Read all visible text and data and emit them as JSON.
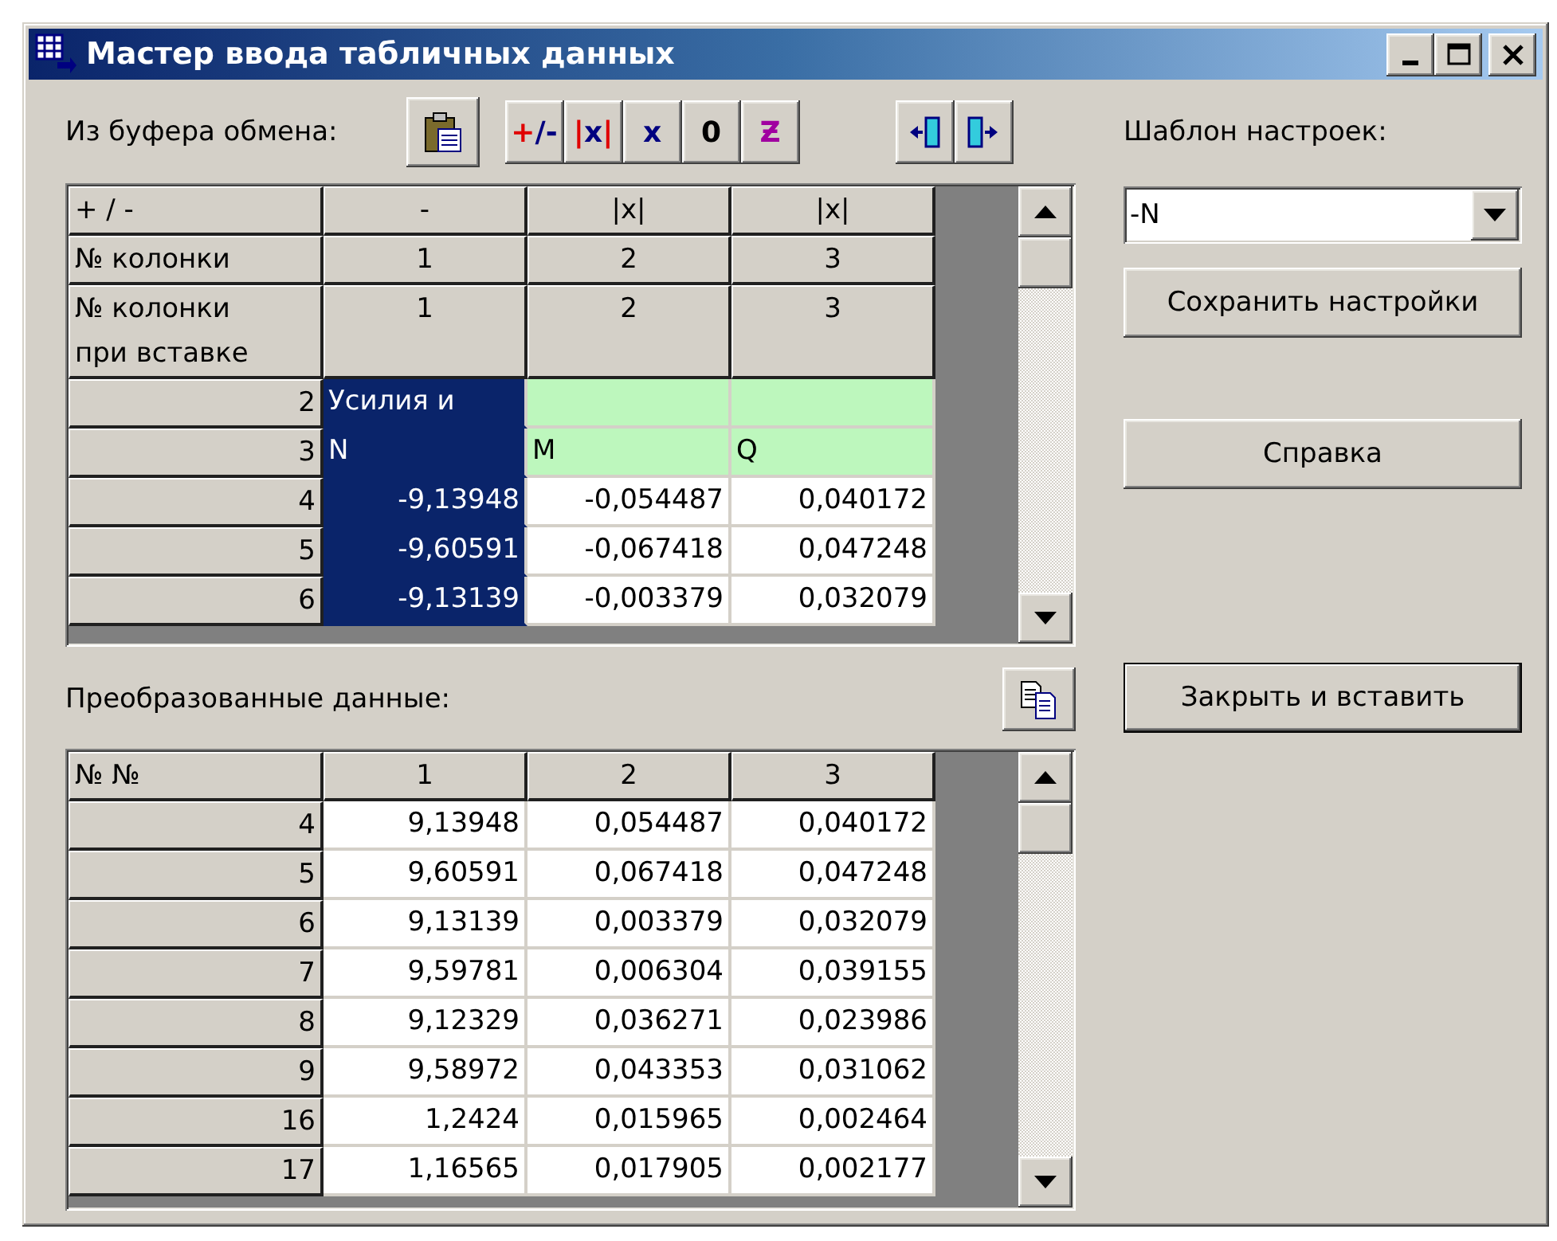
{
  "window": {
    "title": "Мастер ввода табличных данных"
  },
  "source": {
    "label": "Из буфера обмена:",
    "toolbar": [
      [
        {
          "kind": "paste"
        }
      ],
      [
        {
          "kind": "text",
          "parts": [
            {
              "text": "+",
              "color": "#e00000"
            },
            {
              "text": "/-",
              "color": "#000080"
            }
          ]
        },
        {
          "kind": "text",
          "parts": [
            {
              "text": "|",
              "color": "#e00000"
            },
            {
              "text": "x",
              "color": "#000080"
            },
            {
              "text": "|",
              "color": "#e00000"
            }
          ]
        },
        {
          "kind": "text",
          "parts": [
            {
              "text": "x",
              "color": "#000080"
            }
          ]
        },
        {
          "kind": "text",
          "parts": [
            {
              "text": "0",
              "color": "#000000"
            }
          ]
        },
        {
          "kind": "text",
          "parts": [
            {
              "text": "Ƶ",
              "color": "#a000a0"
            }
          ]
        }
      ],
      [
        {
          "kind": "insert-left"
        },
        {
          "kind": "insert-right"
        }
      ]
    ],
    "grid": {
      "columns": [
        {
          "selected": true
        },
        {
          "selected": false
        },
        {
          "selected": false
        }
      ],
      "header_rows": [
        {
          "label": "+ / -",
          "cells": [
            "-",
            "|x|",
            "|x|"
          ]
        },
        {
          "label": "№ колонки",
          "cells": [
            "1",
            "2",
            "3"
          ]
        },
        {
          "label": "№ колонки\nпри вставке",
          "cells": [
            "1",
            "2",
            "3"
          ]
        }
      ],
      "rows": [
        {
          "num": "2",
          "kind": "text",
          "cells": [
            "Усилия и",
            null,
            null
          ]
        },
        {
          "num": "3",
          "kind": "text",
          "cells": [
            "N",
            "M",
            "Q"
          ]
        },
        {
          "num": "4",
          "kind": "number",
          "cells": [
            "-9,13948",
            "-0,054487",
            "0,040172"
          ]
        },
        {
          "num": "5",
          "kind": "number",
          "cells": [
            "-9,60591",
            "-0,067418",
            "0,047248"
          ]
        },
        {
          "num": "6",
          "kind": "number",
          "cells": [
            "-9,13139",
            "-0,003379",
            "0,032079"
          ]
        }
      ]
    }
  },
  "template": {
    "label": "Шаблон настроек:",
    "combo": {
      "value": "-N"
    },
    "buttons": [
      {
        "label": "Сохранить настройки",
        "default": false
      },
      {
        "label": "Справка",
        "default": false
      },
      {
        "label": "Закрыть и вставить",
        "default": true
      }
    ]
  },
  "result": {
    "label": "Преобразованные данные:",
    "grid": {
      "header_rows": [
        {
          "label": "№ №",
          "cells": [
            "1",
            "2",
            "3"
          ]
        }
      ],
      "rows": [
        {
          "num": "4",
          "kind": "number",
          "cells": [
            "9,13948",
            "0,054487",
            "0,040172"
          ]
        },
        {
          "num": "5",
          "kind": "number",
          "cells": [
            "9,60591",
            "0,067418",
            "0,047248"
          ]
        },
        {
          "num": "6",
          "kind": "number",
          "cells": [
            "9,13139",
            "0,003379",
            "0,032079"
          ]
        },
        {
          "num": "7",
          "kind": "number",
          "cells": [
            "9,59781",
            "0,006304",
            "0,039155"
          ]
        },
        {
          "num": "8",
          "kind": "number",
          "cells": [
            "9,12329",
            "0,036271",
            "0,023986"
          ]
        },
        {
          "num": "9",
          "kind": "number",
          "cells": [
            "9,58972",
            "0,043353",
            "0,031062"
          ]
        },
        {
          "num": "16",
          "kind": "number",
          "cells": [
            "1,2424",
            "0,015965",
            "0,002464"
          ]
        },
        {
          "num": "17",
          "kind": "number",
          "cells": [
            "1,16565",
            "0,017905",
            "0,002177"
          ]
        }
      ]
    }
  }
}
